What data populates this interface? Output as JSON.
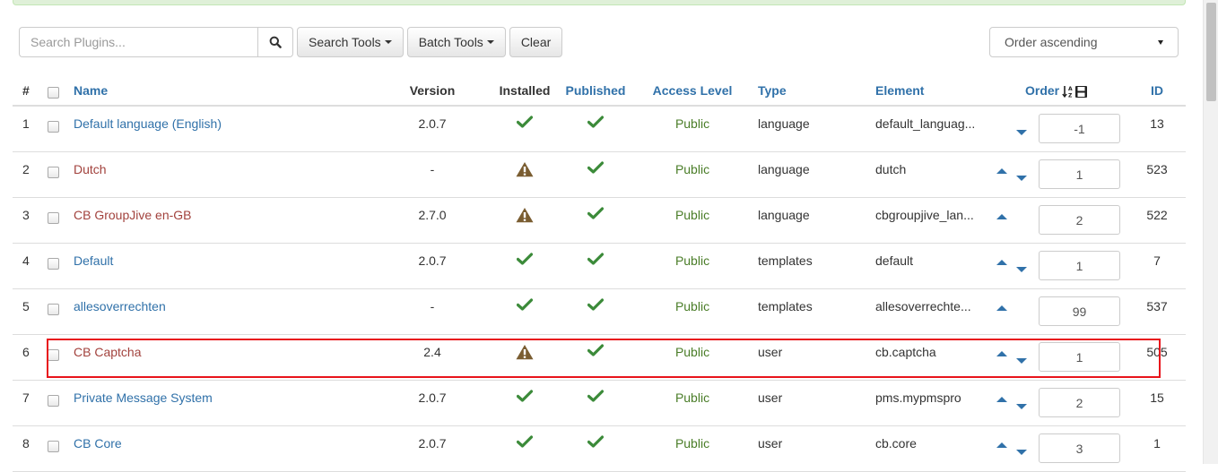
{
  "toolbar": {
    "search_placeholder": "Search Plugins...",
    "search_tools_label": "Search Tools",
    "batch_tools_label": "Batch Tools",
    "clear_label": "Clear",
    "order_select_value": "Order ascending"
  },
  "table": {
    "headers": {
      "num": "#",
      "name": "Name",
      "version": "Version",
      "installed": "Installed",
      "published": "Published",
      "access": "Access Level",
      "type": "Type",
      "element": "Element",
      "order": "Order",
      "id": "ID"
    },
    "rows": [
      {
        "num": "1",
        "name": "Default language (English)",
        "version": "2.0.7",
        "installed": "check-icon",
        "published": "check-icon",
        "access": "Public",
        "type": "language",
        "element": "default_languag...",
        "order": "-1",
        "id": "13"
      },
      {
        "num": "2",
        "name": "Dutch",
        "version": "-",
        "installed": "warning-icon",
        "published": "check-icon",
        "access": "Public",
        "type": "language",
        "element": "dutch",
        "order": "1",
        "id": "523"
      },
      {
        "num": "3",
        "name": "CB GroupJive en-GB",
        "version": "2.7.0",
        "installed": "warning-icon",
        "published": "check-icon",
        "access": "Public",
        "type": "language",
        "element": "cbgroupjive_lan...",
        "order": "2",
        "id": "522"
      },
      {
        "num": "4",
        "name": "Default",
        "version": "2.0.7",
        "installed": "check-icon",
        "published": "check-icon",
        "access": "Public",
        "type": "templates",
        "element": "default",
        "order": "1",
        "id": "7"
      },
      {
        "num": "5",
        "name": "allesoverrechten",
        "version": "-",
        "installed": "check-icon",
        "published": "check-icon",
        "access": "Public",
        "type": "templates",
        "element": "allesoverrechte...",
        "order": "99",
        "id": "537"
      },
      {
        "num": "6",
        "name": "CB Captcha",
        "version": "2.4",
        "installed": "warning-icon",
        "published": "check-icon",
        "access": "Public",
        "type": "user",
        "element": "cb.captcha",
        "order": "1",
        "id": "505"
      },
      {
        "num": "7",
        "name": "Private Message System",
        "version": "2.0.7",
        "installed": "check-icon",
        "published": "check-icon",
        "access": "Public",
        "type": "user",
        "element": "pms.mypmspro",
        "order": "2",
        "id": "15"
      },
      {
        "num": "8",
        "name": "CB Core",
        "version": "2.0.7",
        "installed": "check-icon",
        "published": "check-icon",
        "access": "Public",
        "type": "user",
        "element": "cb.core",
        "order": "3",
        "id": "1"
      }
    ]
  },
  "colors": {
    "link_blue": "#3071a9",
    "link_red": "#a2423d",
    "check_green": "#3c8b3a",
    "warning_brown": "#7a5d31",
    "highlight_red": "#e8141b"
  }
}
